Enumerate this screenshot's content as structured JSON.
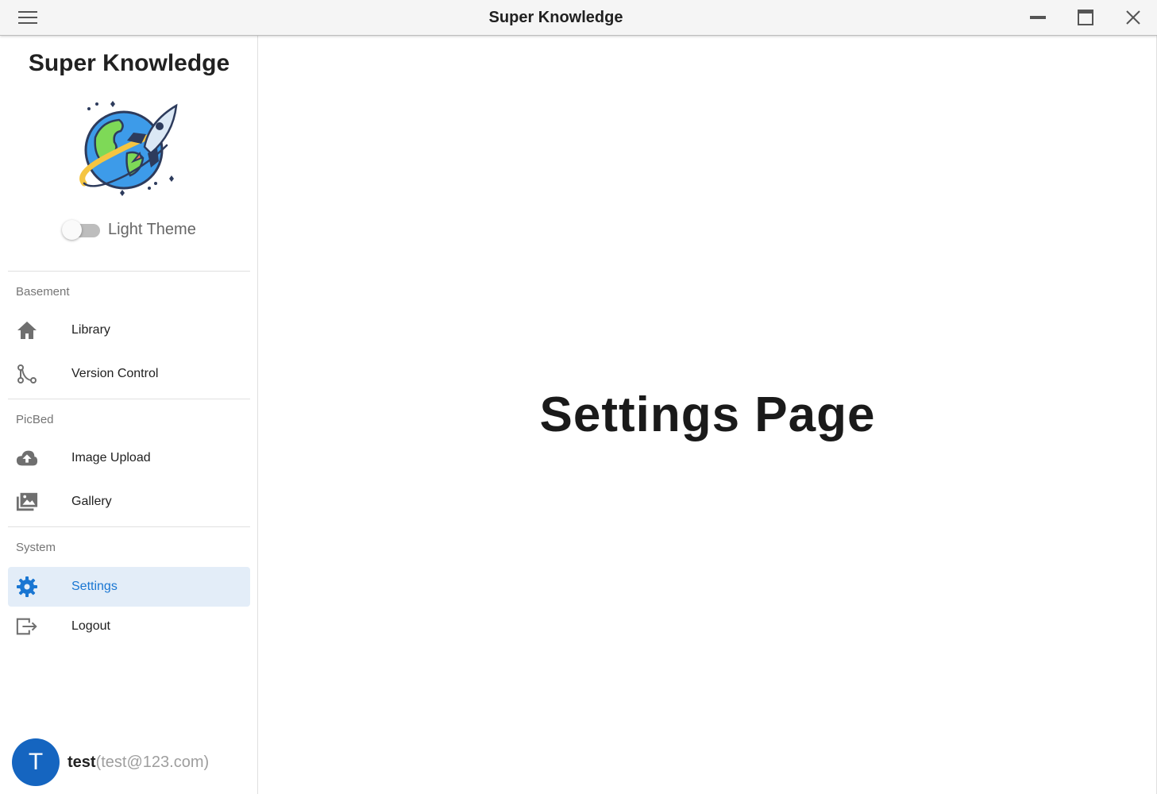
{
  "window": {
    "title": "Super Knowledge"
  },
  "sidebar": {
    "brand": "Super Knowledge",
    "theme_toggle": {
      "label": "Light Theme",
      "on": false
    },
    "sections": [
      {
        "label": "Basement",
        "items": [
          {
            "label": "Library",
            "icon": "home-icon"
          },
          {
            "label": "Version Control",
            "icon": "source-branch-icon"
          }
        ]
      },
      {
        "label": "PicBed",
        "items": [
          {
            "label": "Image Upload",
            "icon": "cloud-upload-icon"
          },
          {
            "label": "Gallery",
            "icon": "image-multiple-icon"
          }
        ]
      },
      {
        "label": "System",
        "items": [
          {
            "label": "Settings",
            "icon": "gear-icon",
            "active": true
          },
          {
            "label": "Logout",
            "icon": "logout-icon"
          }
        ]
      }
    ],
    "user": {
      "initial": "T",
      "name": "test",
      "email": "(test@123.com)"
    }
  },
  "main": {
    "heading": "Settings Page"
  },
  "colors": {
    "accent": "#1976d2",
    "active_bg": "#e3edf8",
    "avatar_bg": "#1565c0",
    "icon_gray": "#6f6f6f"
  }
}
